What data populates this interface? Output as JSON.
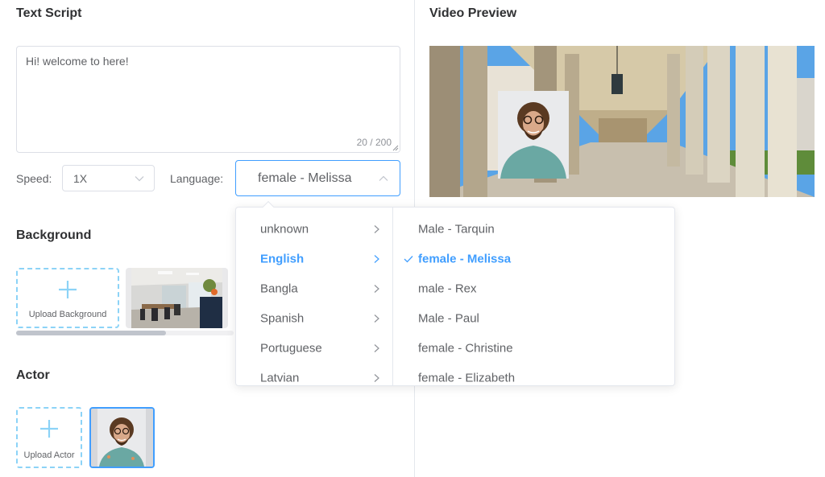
{
  "text_script": {
    "title": "Text Script",
    "value": "Hi! welcome to here!",
    "counter": "20 / 200"
  },
  "speed": {
    "label": "Speed:",
    "value": "1X"
  },
  "language": {
    "label": "Language:",
    "value": "female - Melissa"
  },
  "background": {
    "title": "Background",
    "upload_label": "Upload Background",
    "scroll_fraction": 0.69
  },
  "actor": {
    "title": "Actor",
    "upload_label": "Upload Actor"
  },
  "video_preview": {
    "title": "Video Preview"
  },
  "cascader": {
    "languages": [
      {
        "label": "unknown",
        "active": false
      },
      {
        "label": "English",
        "active": true
      },
      {
        "label": "Bangla",
        "active": false
      },
      {
        "label": "Spanish",
        "active": false
      },
      {
        "label": "Portuguese",
        "active": false
      },
      {
        "label": "Latvian",
        "active": false
      }
    ],
    "voices": [
      {
        "label": "Male - Tarquin",
        "selected": false
      },
      {
        "label": "female - Melissa",
        "selected": true
      },
      {
        "label": "male - Rex",
        "selected": false
      },
      {
        "label": "Male - Paul",
        "selected": false
      },
      {
        "label": "female - Christine",
        "selected": false
      },
      {
        "label": "female - Elizabeth",
        "selected": false
      }
    ]
  },
  "colors": {
    "accent": "#409eff",
    "upload_border": "#8cd3f7",
    "text": "#606266",
    "title": "#303133"
  }
}
